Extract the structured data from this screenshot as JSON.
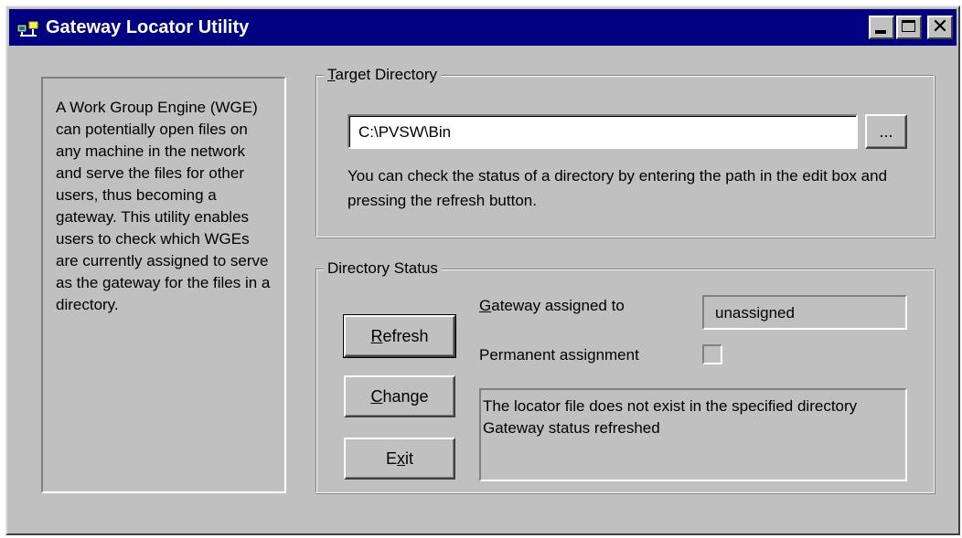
{
  "window": {
    "title": "Gateway Locator Utility",
    "icon": "network-computers-icon",
    "controls": {
      "minimize_icon": "minimize-icon",
      "maximize_icon": "maximize-icon",
      "close_label": "✕"
    }
  },
  "info_panel": {
    "text": "A Work Group Engine (WGE) can potentially open files on any machine in the network and serve the files for other users, thus becoming a gateway. This utility enables users to check which WGEs are currently assigned to serve as the gateway for the files in a directory."
  },
  "target_directory": {
    "legend_mnemonic": "T",
    "legend_rest": "arget Directory",
    "path_value": "C:\\PVSW\\Bin",
    "browse_label": "...",
    "help_text": "You can check the status of a directory by entering the path in the edit box and pressing the refresh button."
  },
  "directory_status": {
    "legend": "Directory Status",
    "buttons": {
      "refresh_mnemonic": "R",
      "refresh_rest": "efresh",
      "change_mnemonic": "C",
      "change_rest": "hange",
      "exit_pre": "E",
      "exit_mnemonic": "x",
      "exit_rest": "it"
    },
    "gateway_label_mnemonic": "G",
    "gateway_label_rest": "ateway assigned to",
    "gateway_value": "unassigned",
    "permanent_label": "Permanent assignment",
    "permanent_checked": false,
    "status_lines": [
      "The locator file does not exist in the specified directory",
      "Gateway status refreshed"
    ]
  },
  "colors": {
    "title_bar": "#000080",
    "face": "#c0c0c0",
    "title_text": "#ffffff"
  }
}
